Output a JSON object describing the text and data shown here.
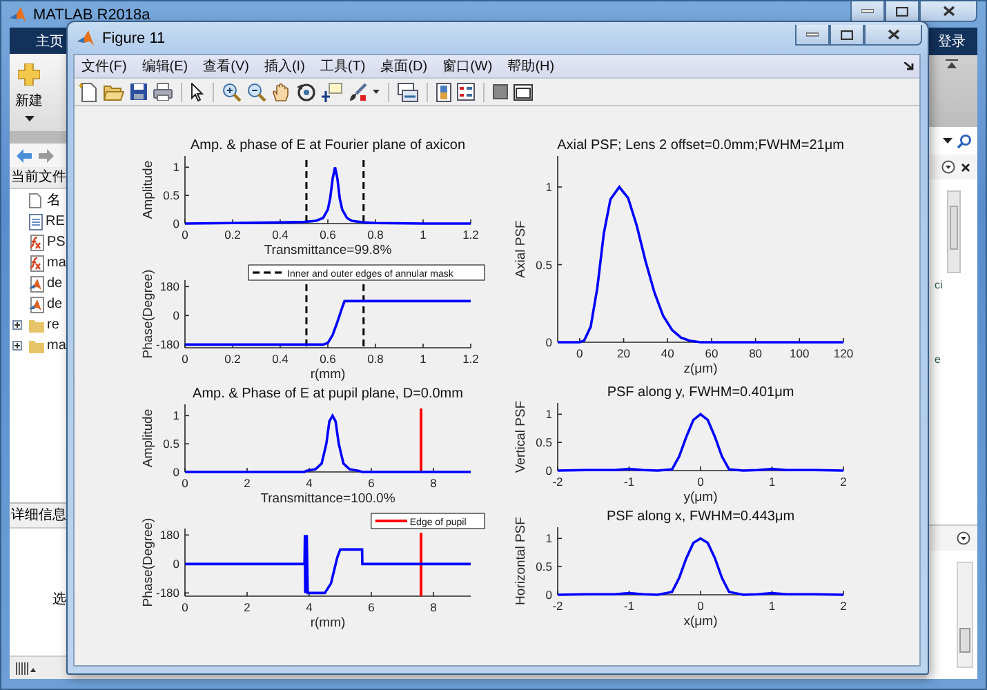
{
  "main_window": {
    "title": "MATLAB R2018a",
    "home_tab": "主页",
    "new_button": "新建",
    "sign_in": "登录",
    "side_texts": [
      "ci",
      "e"
    ]
  },
  "current_folder": {
    "title": "当前文件",
    "column": "名",
    "items": [
      {
        "name": "RE",
        "kind": "text"
      },
      {
        "name": "PS",
        "kind": "function"
      },
      {
        "name": "ma",
        "kind": "function"
      },
      {
        "name": "de",
        "kind": "figure"
      },
      {
        "name": "de",
        "kind": "figure"
      },
      {
        "name": "re",
        "kind": "folder",
        "expanded": false
      },
      {
        "name": "ma",
        "kind": "folder",
        "expanded": false
      }
    ]
  },
  "details_panel": {
    "title": "详细信息",
    "text": "选"
  },
  "figure": {
    "title": "Figure 11",
    "menu": [
      "文件(F)",
      "编辑(E)",
      "查看(V)",
      "插入(I)",
      "工具(T)",
      "桌面(D)",
      "窗口(W)",
      "帮助(H)"
    ],
    "left_plots": [
      {
        "chart_data": {
          "type": "line",
          "title": "Amp. & phase of E at Fourier plane of axicon",
          "xlabel": "Transmittance=99.8%",
          "ylabel": "Amplitude",
          "x": [
            0,
            0.2,
            0.4,
            0.5,
            0.55,
            0.58,
            0.6,
            0.61,
            0.62,
            0.63,
            0.64,
            0.65,
            0.66,
            0.68,
            0.7,
            0.75,
            0.8,
            1.0,
            1.2
          ],
          "series": [
            {
              "color": "#0000ff",
              "values": [
                0,
                0.01,
                0.02,
                0.03,
                0.05,
                0.1,
                0.25,
                0.45,
                0.8,
                1.0,
                0.8,
                0.45,
                0.25,
                0.1,
                0.05,
                0.02,
                0.01,
                0,
                0
              ]
            }
          ],
          "xlim": [
            0,
            1.2
          ],
          "ylim": [
            0,
            1.2
          ],
          "xticks": [
            0,
            0.2,
            0.4,
            0.6,
            0.8,
            1,
            1.2
          ],
          "yticks": [
            0,
            0.5,
            1
          ],
          "ref_lines": [
            {
              "axis": "x",
              "value": 0.51,
              "color": "#000000"
            },
            {
              "axis": "x",
              "value": 0.75,
              "color": "#000000"
            }
          ]
        }
      },
      {
        "chart_data": {
          "type": "line",
          "xlabel": "r(mm)",
          "ylabel": "Phase(Degree)",
          "x": [
            0,
            0.58,
            0.6,
            0.62,
            0.64,
            0.66,
            0.67,
            0.75,
            1.2
          ],
          "series": [
            {
              "color": "#0000ff",
              "values": [
                -180,
                -180,
                -170,
                -120,
                -40,
                50,
                90,
                90,
                90
              ]
            }
          ],
          "xlim": [
            0,
            1.2
          ],
          "ylim": [
            -200,
            220
          ],
          "xticks": [
            0,
            0.2,
            0.4,
            0.6,
            0.8,
            1,
            1.2
          ],
          "yticks": [
            -180,
            0,
            180
          ],
          "ref_lines": [
            {
              "axis": "x",
              "value": 0.51,
              "color": "#000000"
            },
            {
              "axis": "x",
              "value": 0.75,
              "color": "#000000"
            }
          ]
        },
        "legend": {
          "label": "Inner and outer edges of annular mask",
          "color": "#000000"
        }
      },
      {
        "chart_data": {
          "type": "line",
          "title": "Amp. & Phase of E at pupil plane, D=0.0mm",
          "xlabel": "Transmittance=100.0%",
          "ylabel": "Amplitude",
          "x": [
            0,
            3.85,
            3.9,
            4.2,
            4.4,
            4.55,
            4.65,
            4.75,
            4.85,
            4.95,
            5.1,
            5.3,
            5.6,
            5.7,
            9.2
          ],
          "series": [
            {
              "color": "#0000ff",
              "values": [
                0,
                0,
                0.02,
                0.05,
                0.15,
                0.5,
                0.9,
                1.0,
                0.9,
                0.5,
                0.15,
                0.05,
                0.02,
                0,
                0
              ]
            }
          ],
          "xlim": [
            0,
            9.2
          ],
          "ylim": [
            0,
            1.2
          ],
          "xticks": [
            0,
            2,
            4,
            6,
            8
          ],
          "yticks": [
            0,
            0.5,
            1
          ],
          "ref_lines": [
            {
              "axis": "x",
              "value": 7.6,
              "color": "#ff0000"
            }
          ]
        }
      },
      {
        "chart_data": {
          "type": "line",
          "xlabel": "r(mm)",
          "ylabel": "Phase(Degree)",
          "x": [
            0,
            3.85,
            3.86,
            3.87,
            3.88,
            3.89,
            3.9,
            3.91,
            3.92,
            3.95,
            4.5,
            4.7,
            4.9,
            5.0,
            5.7,
            5.71,
            9.2
          ],
          "series": [
            {
              "color": "#0000ff",
              "values": [
                0,
                0,
                180,
                -180,
                180,
                -180,
                180,
                -180,
                180,
                -180,
                -180,
                -120,
                40,
                90,
                90,
                0,
                0
              ]
            }
          ],
          "xlim": [
            0,
            9.2
          ],
          "ylim": [
            -200,
            220
          ],
          "xticks": [
            0,
            2,
            4,
            6,
            8
          ],
          "yticks": [
            -180,
            0,
            180
          ],
          "ref_lines": [
            {
              "axis": "x",
              "value": 7.6,
              "color": "#ff0000"
            }
          ]
        },
        "legend": {
          "label": "Edge of pupil",
          "color": "#ff0000"
        }
      }
    ],
    "right_plots": [
      {
        "chart_data": {
          "type": "line",
          "title": "Axial PSF; Lens 2 offset=0.0mm;FWHM=21μm",
          "xlabel": "z(μm)",
          "ylabel": "Axial PSF",
          "x": [
            -10,
            0,
            2,
            5,
            8,
            11,
            14,
            18,
            22,
            26,
            30,
            34,
            38,
            42,
            46,
            50,
            55,
            60,
            120
          ],
          "series": [
            {
              "color": "#0000ff",
              "values": [
                0,
                0,
                0.01,
                0.1,
                0.35,
                0.7,
                0.92,
                1.0,
                0.93,
                0.75,
                0.52,
                0.32,
                0.17,
                0.08,
                0.03,
                0.01,
                0,
                0,
                0
              ]
            }
          ],
          "xlim": [
            -10,
            120
          ],
          "ylim": [
            0,
            1.2
          ],
          "xticks": [
            0,
            20,
            40,
            60,
            80,
            100,
            120
          ],
          "yticks": [
            0,
            0.5,
            1
          ]
        }
      },
      {
        "chart_data": {
          "type": "line",
          "title": "PSF along y, FWHM=0.401μm",
          "xlabel": "y(μm)",
          "ylabel": "Vertical PSF",
          "x": [
            -2,
            -1.6,
            -1.2,
            -1,
            -0.8,
            -0.6,
            -0.4,
            -0.3,
            -0.2,
            -0.1,
            0,
            0.1,
            0.2,
            0.3,
            0.4,
            0.6,
            0.8,
            1,
            1.2,
            1.6,
            2
          ],
          "series": [
            {
              "color": "#0000ff",
              "values": [
                0,
                0.01,
                0.01,
                0.03,
                0.01,
                0,
                0.02,
                0.25,
                0.6,
                0.9,
                1,
                0.9,
                0.6,
                0.25,
                0.02,
                0,
                0.01,
                0.03,
                0.01,
                0.01,
                0
              ]
            }
          ],
          "xlim": [
            -2,
            2
          ],
          "ylim": [
            0,
            1.2
          ],
          "xticks": [
            -2,
            -1,
            0,
            1,
            2
          ],
          "yticks": [
            0,
            0.5,
            1
          ]
        }
      },
      {
        "chart_data": {
          "type": "line",
          "title": "PSF along x, FWHM=0.443μm",
          "xlabel": "x(μm)",
          "ylabel": "Horizontal PSF",
          "x": [
            -2,
            -1.6,
            -1.2,
            -1,
            -0.8,
            -0.6,
            -0.4,
            -0.3,
            -0.2,
            -0.1,
            0,
            0.1,
            0.2,
            0.3,
            0.4,
            0.6,
            0.8,
            1,
            1.2,
            1.6,
            2
          ],
          "series": [
            {
              "color": "#0000ff",
              "values": [
                0,
                0.01,
                0.01,
                0.03,
                0.01,
                0,
                0.05,
                0.3,
                0.65,
                0.92,
                1,
                0.92,
                0.65,
                0.3,
                0.05,
                0,
                0.01,
                0.03,
                0.01,
                0.01,
                0
              ]
            }
          ],
          "xlim": [
            -2,
            2
          ],
          "ylim": [
            0,
            1.2
          ],
          "xticks": [
            -2,
            -1,
            0,
            1,
            2
          ],
          "yticks": [
            0,
            0.5,
            1
          ]
        }
      }
    ]
  }
}
